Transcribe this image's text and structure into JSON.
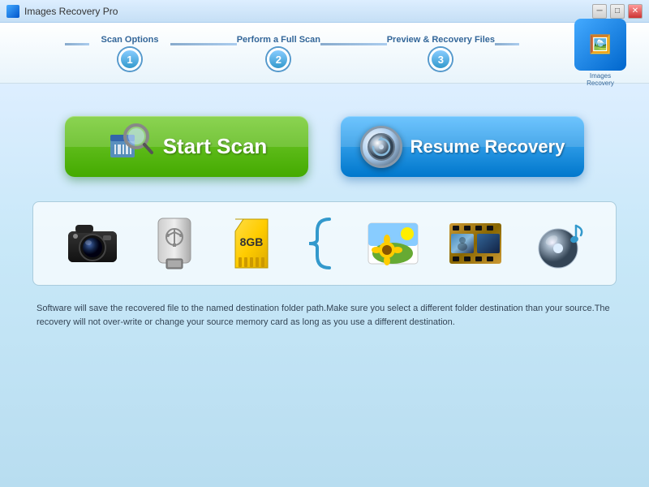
{
  "window": {
    "title": "Images Recovery Pro",
    "controls": {
      "minimize": "─",
      "maximize": "□",
      "close": "✕"
    }
  },
  "wizard": {
    "steps": [
      {
        "number": "1",
        "label": "Scan Options"
      },
      {
        "number": "2",
        "label": "Perform a Full Scan"
      },
      {
        "number": "3",
        "label": "Preview & Recovery Files"
      }
    ],
    "logo": {
      "line1": "Images",
      "line2": "Recovery"
    }
  },
  "buttons": {
    "start_scan": "Start Scan",
    "resume_recovery": "Resume Recovery"
  },
  "icons": {
    "sd_card_label": "8GB",
    "brace": "}"
  },
  "footer_text": "Software will save the recovered file to the named destination folder path.Make sure you select a different folder destination than your source.The recovery will not over-write or change your source memory card as long as you use a different destination."
}
